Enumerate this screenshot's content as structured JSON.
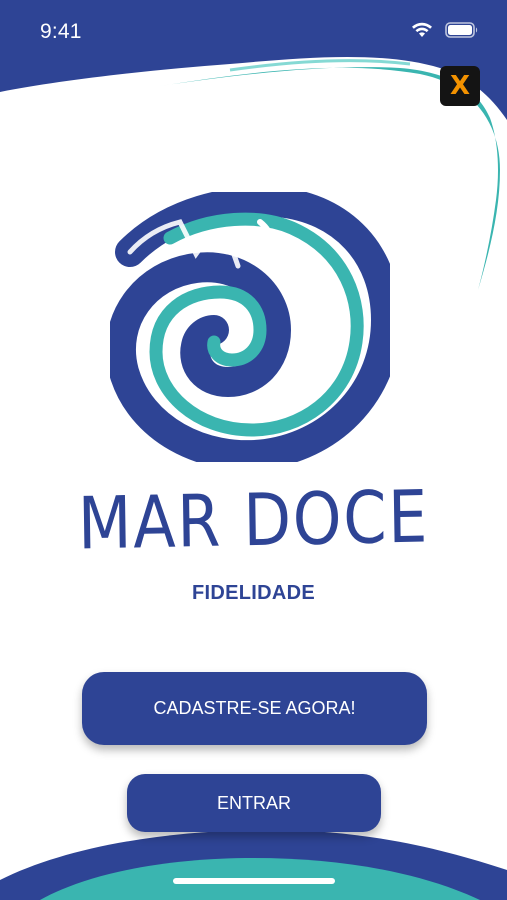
{
  "status_bar": {
    "time": "9:41",
    "icons": [
      "wifi-icon",
      "battery-icon"
    ]
  },
  "badge": {
    "glyph": "X",
    "icon": "x-app-badge-icon"
  },
  "brand": {
    "name": "MAR DOCE",
    "subtitle": "FIDELIDADE"
  },
  "actions": {
    "register_label": "CADASTRE-SE AGORA!",
    "enter_label": "ENTRAR"
  },
  "colors": {
    "primary_blue": "#2e4495",
    "teal": "#3ab5b0",
    "badge_orange": "#f39200",
    "background": "#ffffff"
  }
}
